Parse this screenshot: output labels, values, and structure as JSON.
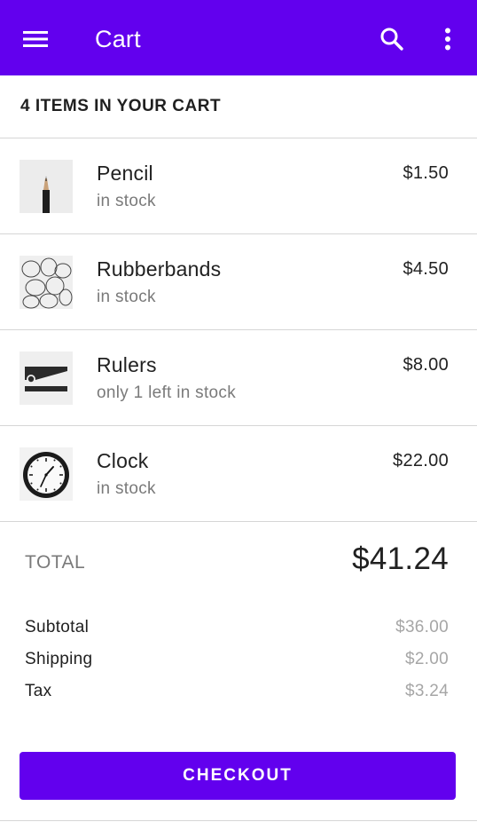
{
  "colors": {
    "primary": "#6200ee",
    "on_primary": "#ffffff",
    "secondary_text": "#7a7a7a",
    "muted_value": "#a6a6a6",
    "divider": "#d6d6d6"
  },
  "appbar": {
    "title": "Cart",
    "icons": [
      "menu-icon",
      "search-icon",
      "more-vert-icon"
    ]
  },
  "cart": {
    "count_label": "4 ITEMS IN YOUR CART",
    "items": [
      {
        "name": "Pencil",
        "stock": "in stock",
        "price": "$1.50",
        "thumb": "pencil-image"
      },
      {
        "name": "Rubberbands",
        "stock": "in stock",
        "price": "$4.50",
        "thumb": "rubberbands-image"
      },
      {
        "name": "Rulers",
        "stock": "only 1 left in stock",
        "price": "$8.00",
        "thumb": "rulers-image"
      },
      {
        "name": "Clock",
        "stock": "in stock",
        "price": "$22.00",
        "thumb": "clock-image"
      }
    ]
  },
  "totals": {
    "total_label": "TOTAL",
    "total_value": "$41.24",
    "rows": [
      {
        "label": "Subtotal",
        "value": "$36.00"
      },
      {
        "label": "Shipping",
        "value": "$2.00"
      },
      {
        "label": "Tax",
        "value": "$3.24"
      }
    ]
  },
  "checkout_label": "CHECKOUT"
}
